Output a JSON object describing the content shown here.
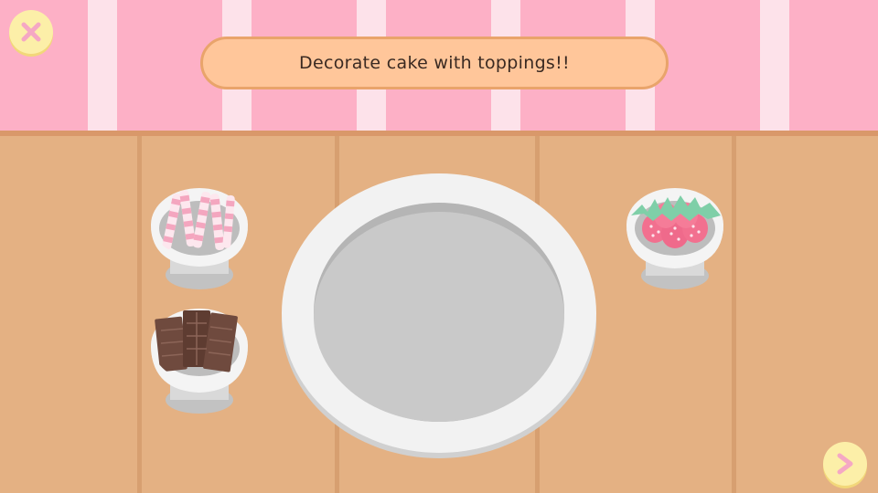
{
  "banner": {
    "text": "Decorate cake with toppings!!"
  },
  "buttons": {
    "close_icon": "close-x-icon",
    "next_icon": "chevron-right-icon"
  },
  "toppings": [
    "wafer-sticks",
    "chocolate-bars",
    "strawberries"
  ],
  "colors": {
    "wall": "#fdb0c6",
    "wall_stripe": "#fde2ea",
    "table": "#e4b183",
    "banner_fill": "#ffc69a",
    "banner_border": "#e9a46b",
    "button_fill": "#fcefa8",
    "icon_pink": "#f5a8c4",
    "plate": "#f2f2f2",
    "plate_center": "#c8c8c8"
  }
}
